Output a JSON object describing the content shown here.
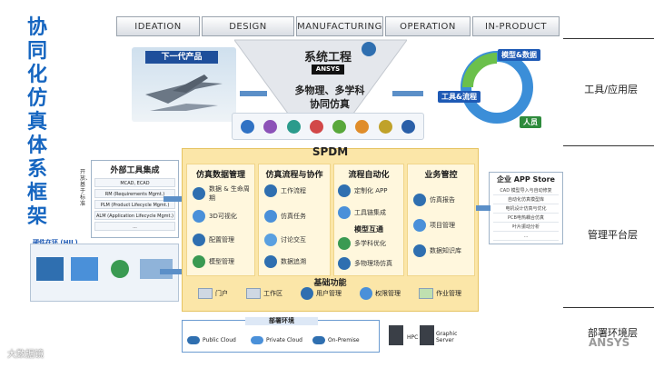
{
  "left_title": [
    "协",
    "同",
    "化",
    "仿",
    "真",
    "体",
    "系",
    "框",
    "架"
  ],
  "phases": [
    "IDEATION",
    "DESIGN",
    "MANUFACTURING",
    "OPERATION",
    "IN-PRODUCT"
  ],
  "layers": {
    "tools": "工具/应用层",
    "platform": "管理平台层",
    "deploy": "部署环境层"
  },
  "top": {
    "product": "下一代产品",
    "system_eng": "系统工程",
    "ansys": "ANSYS",
    "multi_physics": "多物理、多学科",
    "co_sim": "协同仿真",
    "model_data": "模型&数据",
    "tools_flow": "工具&流程",
    "people": "人员"
  },
  "spdm": {
    "title": "SPDM",
    "columns": [
      {
        "title": "仿真数据管理",
        "items": [
          "数据 & 生命周期",
          "3D可视化",
          "配置管理",
          "模型管理"
        ]
      },
      {
        "title": "仿真流程与协作",
        "items": [
          "工作流程",
          "仿真任务",
          "讨论交互",
          "数据追溯"
        ]
      },
      {
        "title": "流程自动化",
        "items": [
          "定制化 APP",
          "工具链集成"
        ],
        "subtitle": "模型互通",
        "sub_items": [
          "多学科优化",
          "多物理场仿真"
        ]
      },
      {
        "title": "业务管控",
        "items": [
          "仿真报告",
          "项目管理",
          "数据知识库"
        ]
      }
    ],
    "base_title": "基础功能",
    "base_items": [
      "门户",
      "工作区",
      "用户管理",
      "权限管理",
      "作业管理"
    ]
  },
  "external": {
    "title": "外部工具集成",
    "side_label": "开放、基于标准",
    "items": [
      "MCAD, ECAD",
      "RM (Requirements Mgmt.)",
      "PLM (Product Lifecycle Mgmt.)",
      "ALM (Application Lifecycle Mgmt.)",
      "..."
    ]
  },
  "hardware": {
    "label": "硬件在环 (HIL)"
  },
  "app_store": {
    "title": "企业 APP Store",
    "items": [
      "CAD 模型导入与自动修复",
      "自动化仿真模型库",
      "电机设计仿真与优化",
      "PCB电热耦合仿真",
      "叶片振动分析",
      "..."
    ]
  },
  "deploy": {
    "title": "部署环境",
    "items": [
      "Public Cloud",
      "Private Cloud",
      "On-Premise"
    ],
    "hpc": "HPC",
    "graphic": "Graphic Server"
  },
  "watermark": "大数据镜",
  "brand": "ANSYS"
}
